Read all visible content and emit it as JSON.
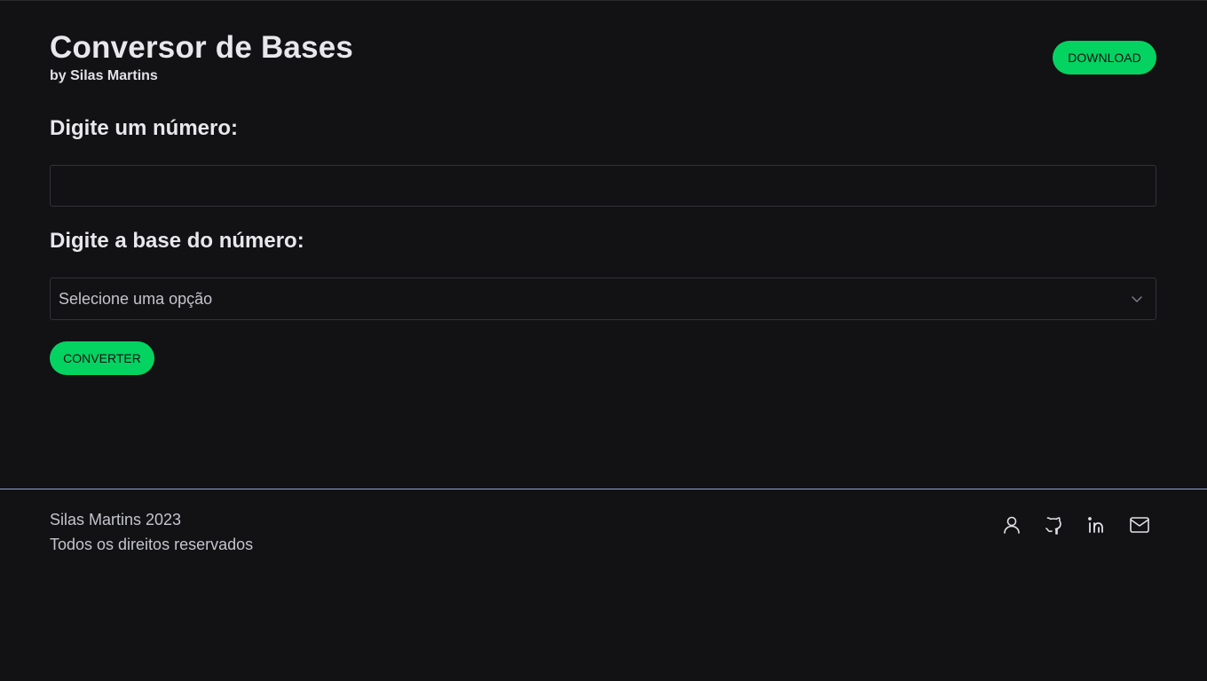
{
  "header": {
    "title": "Conversor de Bases",
    "subtitle": "by Silas Martins",
    "download_label": "DOWNLOAD"
  },
  "form": {
    "number_label": "Digite um número:",
    "number_value": "",
    "number_placeholder": "",
    "base_label": "Digite a base do número:",
    "base_selected": "Selecione uma opção",
    "convert_label": "CONVERTER"
  },
  "footer": {
    "line1": "Silas Martins 2023",
    "line2": "Todos os direitos reservados",
    "social": [
      {
        "icon": "user-icon"
      },
      {
        "icon": "github-icon"
      },
      {
        "icon": "linkedin-icon"
      },
      {
        "icon": "mail-icon"
      }
    ]
  },
  "colors": {
    "background": "#121214",
    "accent": "#04d361",
    "text": "#e1e1e6",
    "border": "#323238",
    "footer_line": "#8fa3d4"
  }
}
